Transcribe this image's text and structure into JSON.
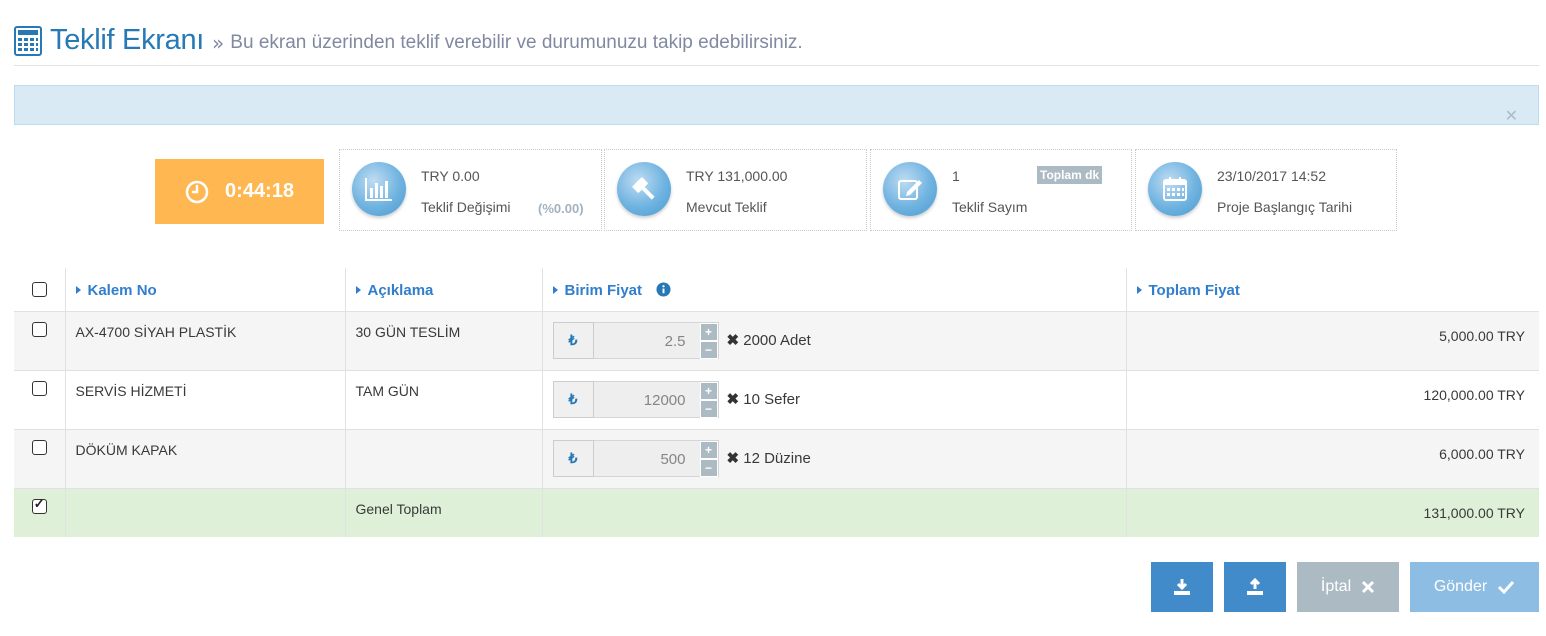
{
  "header": {
    "title": "Teklif Ekranı",
    "separator": "»",
    "subtitle": "Bu ekran üzerinden teklif verebilir ve durumunuzu takip edebilirsiniz."
  },
  "alert": {
    "close_icon": "close-icon"
  },
  "timer": {
    "value": "0:44:18",
    "icon": "clock-icon"
  },
  "stats": [
    {
      "icon": "bar-chart-icon",
      "value": "TRY 0.00",
      "label": "Teklif Değişimi",
      "extra": "(%0.00)"
    },
    {
      "icon": "gavel-icon",
      "value": "TRY 131,000.00",
      "label": "Mevcut Teklif"
    },
    {
      "icon": "edit-icon",
      "value": "1",
      "label": "Teklif Sayım",
      "badge": "Toplam dk"
    },
    {
      "icon": "calendar-icon",
      "value": "23/10/2017 14:52",
      "label": "Proje Başlangıç Tarihi"
    }
  ],
  "table": {
    "headers": {
      "item_no": "Kalem No",
      "description": "Açıklama",
      "unit_price": "Birim Fiyat",
      "total_price": "Toplam Fiyat"
    },
    "rows": [
      {
        "item_no": "AX-4700 SİYAH PLASTİK",
        "description": "30 GÜN TESLİM",
        "currency": "₺",
        "price": "2.5",
        "multiplier": "✖",
        "quantity": "2000 Adet",
        "total": "5,000.00 TRY"
      },
      {
        "item_no": "SERVİS HİZMETİ",
        "description": "TAM GÜN",
        "currency": "₺",
        "price": "12000",
        "multiplier": "✖",
        "quantity": "10 Sefer",
        "total": "120,000.00 TRY"
      },
      {
        "item_no": "DÖKÜM KAPAK",
        "description": "",
        "currency": "₺",
        "price": "500",
        "multiplier": "✖",
        "quantity": "12 Düzine",
        "total": "6,000.00 TRY"
      }
    ],
    "grand_total": {
      "label": "Genel Toplam",
      "total": "131,000.00 TRY"
    },
    "spin_up": "+",
    "spin_down": "−"
  },
  "buttons": {
    "download_icon": "download-icon",
    "upload_icon": "upload-icon",
    "cancel_label": "İptal",
    "send_label": "Gönder"
  },
  "colors": {
    "primary": "#2679b5",
    "timer": "#ffb752",
    "alert": "#d9eaf5",
    "total_row": "#dff0d8",
    "button_blue": "#428bca",
    "button_grey": "#abbac3",
    "button_light": "#8ebde4"
  }
}
